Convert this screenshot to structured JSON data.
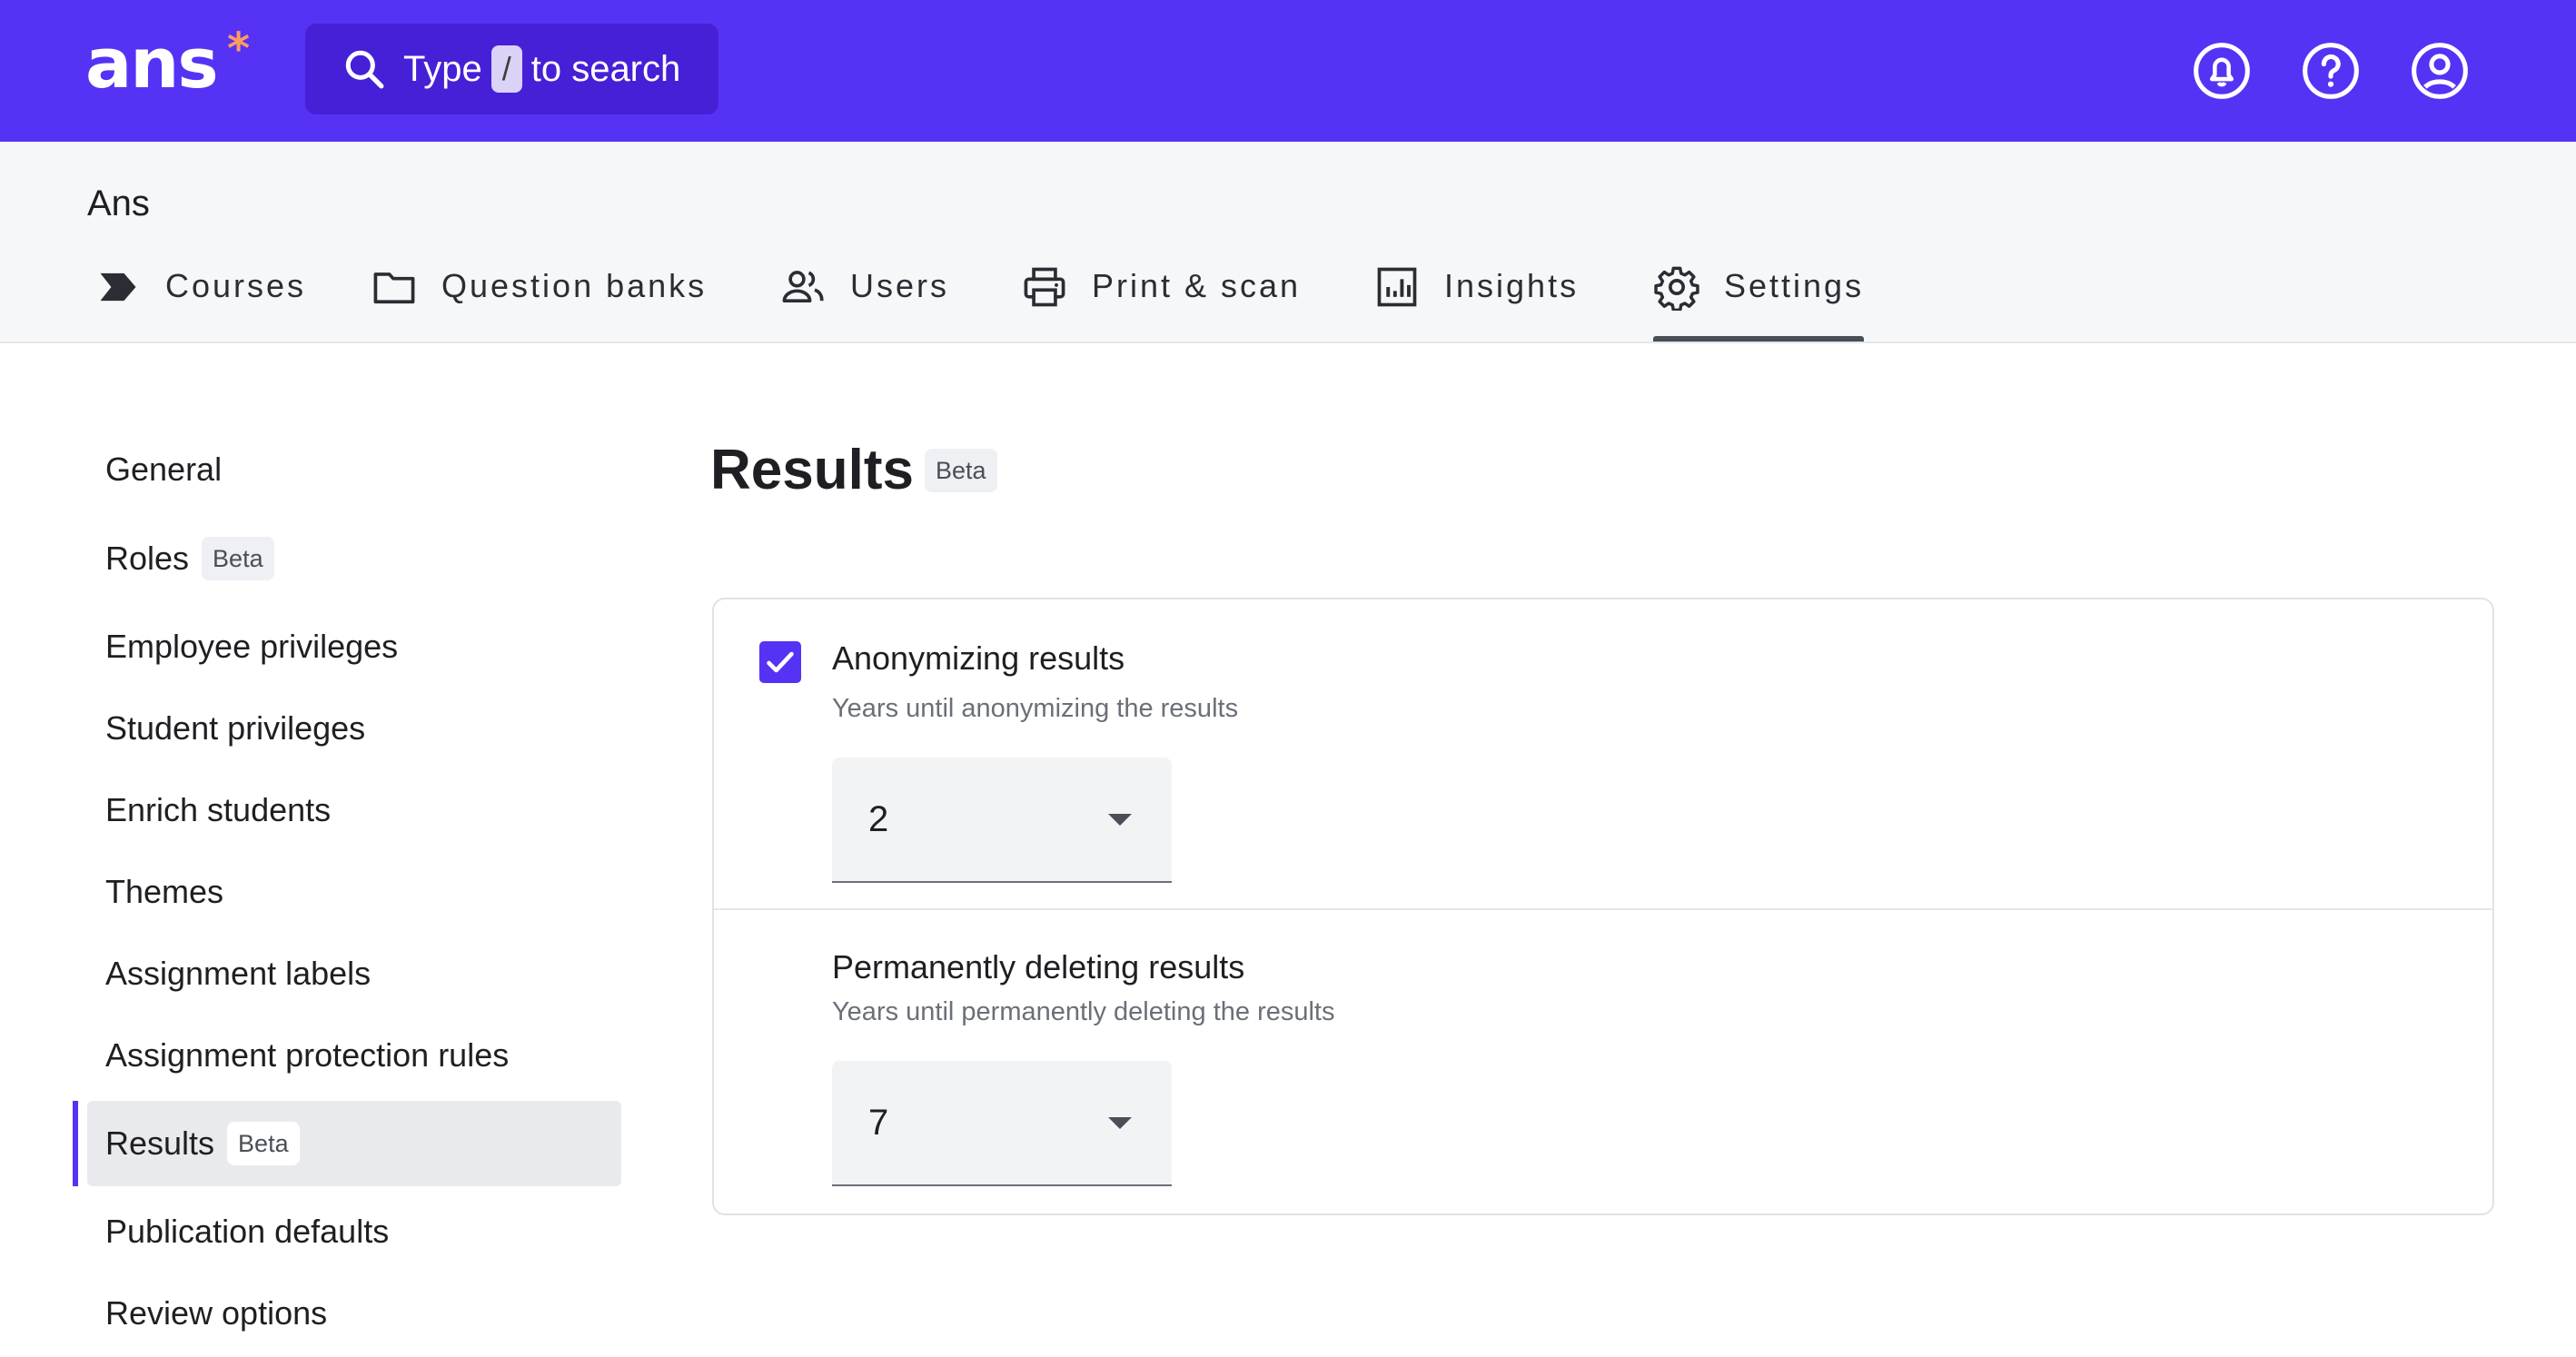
{
  "app": {
    "logo_text": "ans",
    "logo_star": "*",
    "accent_color": "#5632f5"
  },
  "search": {
    "prefix": "Type",
    "key": "/",
    "suffix": "to search",
    "icon": "search-icon"
  },
  "top_icons": [
    "notifications-icon",
    "help-icon",
    "account-icon"
  ],
  "org": {
    "name": "Ans"
  },
  "tabs": [
    {
      "label": "Courses",
      "icon": "courses-icon"
    },
    {
      "label": "Question banks",
      "icon": "folder-icon"
    },
    {
      "label": "Users",
      "icon": "users-icon"
    },
    {
      "label": "Print & scan",
      "icon": "printer-icon"
    },
    {
      "label": "Insights",
      "icon": "chart-icon"
    },
    {
      "label": "Settings",
      "icon": "gear-icon",
      "active": true
    }
  ],
  "sidebar": {
    "items": [
      {
        "label": "General"
      },
      {
        "label": "Roles",
        "badge": "Beta"
      },
      {
        "label": "Employee privileges"
      },
      {
        "label": "Student privileges"
      },
      {
        "label": "Enrich students"
      },
      {
        "label": "Themes"
      },
      {
        "label": "Assignment labels"
      },
      {
        "label": "Assignment protection rules"
      },
      {
        "label": "Results",
        "badge": "Beta",
        "active": true
      },
      {
        "label": "Publication defaults"
      },
      {
        "label": "Review options"
      }
    ]
  },
  "main": {
    "title": "Results",
    "title_badge": "Beta",
    "anonymize": {
      "checked": true,
      "title": "Anonymizing results",
      "subtitle": "Years until anonymizing the results",
      "value": "2"
    },
    "delete": {
      "title": "Permanently deleting results",
      "subtitle": "Years until permanently deleting the results",
      "value": "7"
    }
  }
}
